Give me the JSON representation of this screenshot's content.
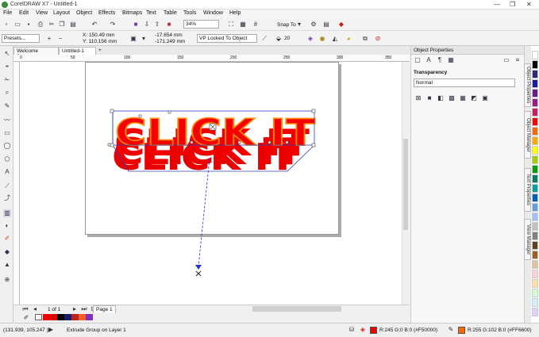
{
  "window": {
    "title": "CorelDRAW X7 - Untitled-1",
    "min": "—",
    "max": "❐",
    "close": "✕"
  },
  "menu": [
    "File",
    "Edit",
    "View",
    "Layout",
    "Object",
    "Effects",
    "Bitmaps",
    "Text",
    "Table",
    "Tools",
    "Window",
    "Help"
  ],
  "toolbar": {
    "zoom": "34%",
    "snap": "Snap To"
  },
  "propbar": {
    "preset": "Presets...",
    "x": "X: 150.49 mm",
    "y": "Y: 110.156 mm",
    "vx": "-17.654 mm",
    "vy": "-171.249 mm",
    "vp_mode": "VP Locked To Object",
    "depth": "20"
  },
  "tabs": {
    "welcome": "Welcome Screen",
    "doc": "Untitled-1",
    "add": "+"
  },
  "ruler_labels": [
    "0",
    "50",
    "100",
    "150",
    "200",
    "250",
    "300",
    "350",
    "400"
  ],
  "artwork": {
    "text": "CLICK IT",
    "face_color": "#F50000",
    "extrude_color": "#E80000",
    "outline": "#FF8800"
  },
  "pagenav": {
    "counter": "1 of 1",
    "page": "Page 1"
  },
  "docker": {
    "title": "Object Properties",
    "section": "Transparency",
    "mode": "Normal",
    "vtabs": [
      "Object Properties",
      "Object Manager",
      "Text Properties",
      "View Manager"
    ]
  },
  "status": {
    "coords": "(131.939, 105.247 )",
    "info": "Extrude Group on Layer 1",
    "fill": "R:245 G:0 B:0 (#F50000)",
    "outline": "R:255 G:102 B:0 (#FF6600)",
    "fill_color": "#F50000",
    "outline_color": "#FF6600"
  },
  "palette": [
    "#ffffff",
    "#000000",
    "#2a2a7a",
    "#1a1aa0",
    "#6a1a8a",
    "#9a1a8a",
    "#d01a60",
    "#ff0000",
    "#ff6600",
    "#ffaa00",
    "#ffff00",
    "#a0d000",
    "#00a000",
    "#008060",
    "#00a0a0",
    "#0060c0",
    "#60a0e0",
    "#a0c0ff",
    "#c0c0c0",
    "#808080",
    "#604020",
    "#a06020",
    "#e0c0a0",
    "#ffd0d0",
    "#ffe0a0",
    "#d0ffd0",
    "#d0f0ff",
    "#e0d0ff"
  ]
}
